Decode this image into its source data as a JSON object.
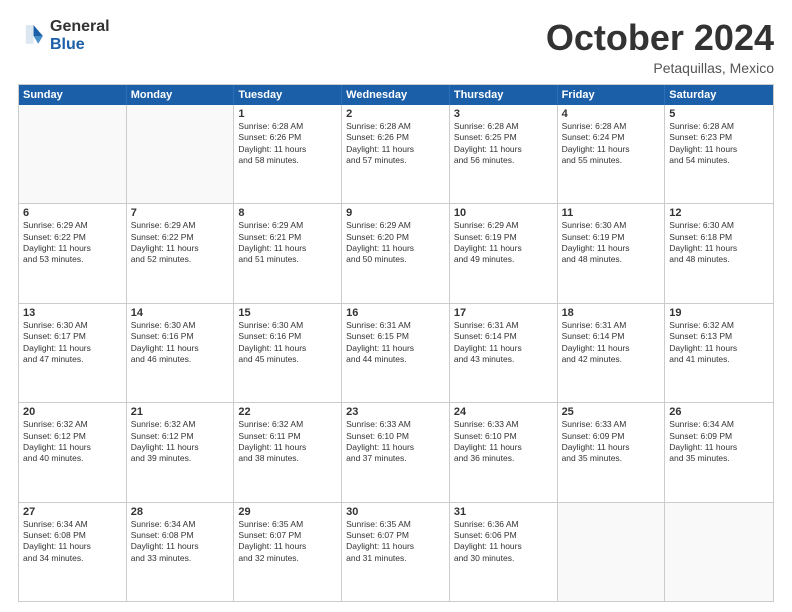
{
  "logo": {
    "line1": "General",
    "line2": "Blue"
  },
  "header": {
    "month": "October 2024",
    "location": "Petaquillas, Mexico"
  },
  "days": [
    "Sunday",
    "Monday",
    "Tuesday",
    "Wednesday",
    "Thursday",
    "Friday",
    "Saturday"
  ],
  "rows": [
    [
      {
        "num": "",
        "lines": []
      },
      {
        "num": "",
        "lines": []
      },
      {
        "num": "1",
        "lines": [
          "Sunrise: 6:28 AM",
          "Sunset: 6:26 PM",
          "Daylight: 11 hours",
          "and 58 minutes."
        ]
      },
      {
        "num": "2",
        "lines": [
          "Sunrise: 6:28 AM",
          "Sunset: 6:26 PM",
          "Daylight: 11 hours",
          "and 57 minutes."
        ]
      },
      {
        "num": "3",
        "lines": [
          "Sunrise: 6:28 AM",
          "Sunset: 6:25 PM",
          "Daylight: 11 hours",
          "and 56 minutes."
        ]
      },
      {
        "num": "4",
        "lines": [
          "Sunrise: 6:28 AM",
          "Sunset: 6:24 PM",
          "Daylight: 11 hours",
          "and 55 minutes."
        ]
      },
      {
        "num": "5",
        "lines": [
          "Sunrise: 6:28 AM",
          "Sunset: 6:23 PM",
          "Daylight: 11 hours",
          "and 54 minutes."
        ]
      }
    ],
    [
      {
        "num": "6",
        "lines": [
          "Sunrise: 6:29 AM",
          "Sunset: 6:22 PM",
          "Daylight: 11 hours",
          "and 53 minutes."
        ]
      },
      {
        "num": "7",
        "lines": [
          "Sunrise: 6:29 AM",
          "Sunset: 6:22 PM",
          "Daylight: 11 hours",
          "and 52 minutes."
        ]
      },
      {
        "num": "8",
        "lines": [
          "Sunrise: 6:29 AM",
          "Sunset: 6:21 PM",
          "Daylight: 11 hours",
          "and 51 minutes."
        ]
      },
      {
        "num": "9",
        "lines": [
          "Sunrise: 6:29 AM",
          "Sunset: 6:20 PM",
          "Daylight: 11 hours",
          "and 50 minutes."
        ]
      },
      {
        "num": "10",
        "lines": [
          "Sunrise: 6:29 AM",
          "Sunset: 6:19 PM",
          "Daylight: 11 hours",
          "and 49 minutes."
        ]
      },
      {
        "num": "11",
        "lines": [
          "Sunrise: 6:30 AM",
          "Sunset: 6:19 PM",
          "Daylight: 11 hours",
          "and 48 minutes."
        ]
      },
      {
        "num": "12",
        "lines": [
          "Sunrise: 6:30 AM",
          "Sunset: 6:18 PM",
          "Daylight: 11 hours",
          "and 48 minutes."
        ]
      }
    ],
    [
      {
        "num": "13",
        "lines": [
          "Sunrise: 6:30 AM",
          "Sunset: 6:17 PM",
          "Daylight: 11 hours",
          "and 47 minutes."
        ]
      },
      {
        "num": "14",
        "lines": [
          "Sunrise: 6:30 AM",
          "Sunset: 6:16 PM",
          "Daylight: 11 hours",
          "and 46 minutes."
        ]
      },
      {
        "num": "15",
        "lines": [
          "Sunrise: 6:30 AM",
          "Sunset: 6:16 PM",
          "Daylight: 11 hours",
          "and 45 minutes."
        ]
      },
      {
        "num": "16",
        "lines": [
          "Sunrise: 6:31 AM",
          "Sunset: 6:15 PM",
          "Daylight: 11 hours",
          "and 44 minutes."
        ]
      },
      {
        "num": "17",
        "lines": [
          "Sunrise: 6:31 AM",
          "Sunset: 6:14 PM",
          "Daylight: 11 hours",
          "and 43 minutes."
        ]
      },
      {
        "num": "18",
        "lines": [
          "Sunrise: 6:31 AM",
          "Sunset: 6:14 PM",
          "Daylight: 11 hours",
          "and 42 minutes."
        ]
      },
      {
        "num": "19",
        "lines": [
          "Sunrise: 6:32 AM",
          "Sunset: 6:13 PM",
          "Daylight: 11 hours",
          "and 41 minutes."
        ]
      }
    ],
    [
      {
        "num": "20",
        "lines": [
          "Sunrise: 6:32 AM",
          "Sunset: 6:12 PM",
          "Daylight: 11 hours",
          "and 40 minutes."
        ]
      },
      {
        "num": "21",
        "lines": [
          "Sunrise: 6:32 AM",
          "Sunset: 6:12 PM",
          "Daylight: 11 hours",
          "and 39 minutes."
        ]
      },
      {
        "num": "22",
        "lines": [
          "Sunrise: 6:32 AM",
          "Sunset: 6:11 PM",
          "Daylight: 11 hours",
          "and 38 minutes."
        ]
      },
      {
        "num": "23",
        "lines": [
          "Sunrise: 6:33 AM",
          "Sunset: 6:10 PM",
          "Daylight: 11 hours",
          "and 37 minutes."
        ]
      },
      {
        "num": "24",
        "lines": [
          "Sunrise: 6:33 AM",
          "Sunset: 6:10 PM",
          "Daylight: 11 hours",
          "and 36 minutes."
        ]
      },
      {
        "num": "25",
        "lines": [
          "Sunrise: 6:33 AM",
          "Sunset: 6:09 PM",
          "Daylight: 11 hours",
          "and 35 minutes."
        ]
      },
      {
        "num": "26",
        "lines": [
          "Sunrise: 6:34 AM",
          "Sunset: 6:09 PM",
          "Daylight: 11 hours",
          "and 35 minutes."
        ]
      }
    ],
    [
      {
        "num": "27",
        "lines": [
          "Sunrise: 6:34 AM",
          "Sunset: 6:08 PM",
          "Daylight: 11 hours",
          "and 34 minutes."
        ]
      },
      {
        "num": "28",
        "lines": [
          "Sunrise: 6:34 AM",
          "Sunset: 6:08 PM",
          "Daylight: 11 hours",
          "and 33 minutes."
        ]
      },
      {
        "num": "29",
        "lines": [
          "Sunrise: 6:35 AM",
          "Sunset: 6:07 PM",
          "Daylight: 11 hours",
          "and 32 minutes."
        ]
      },
      {
        "num": "30",
        "lines": [
          "Sunrise: 6:35 AM",
          "Sunset: 6:07 PM",
          "Daylight: 11 hours",
          "and 31 minutes."
        ]
      },
      {
        "num": "31",
        "lines": [
          "Sunrise: 6:36 AM",
          "Sunset: 6:06 PM",
          "Daylight: 11 hours",
          "and 30 minutes."
        ]
      },
      {
        "num": "",
        "lines": []
      },
      {
        "num": "",
        "lines": []
      }
    ]
  ]
}
